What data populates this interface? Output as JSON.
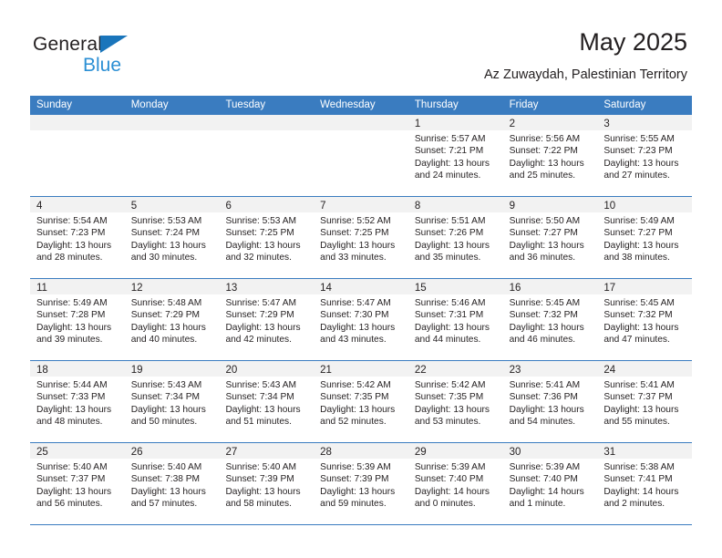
{
  "brand": {
    "name_dark": "General",
    "name_blue": "Blue",
    "triangle_color": "#1a75bb",
    "blue_text_color": "#2b8fd4"
  },
  "header": {
    "title": "May 2025",
    "subtitle": "Az Zuwaydah, Palestinian Territory"
  },
  "theme": {
    "header_row_bg": "#3a7cc0",
    "header_row_text": "#ffffff",
    "daynum_band_bg": "#f2f2f2",
    "grid_line": "#3a7cc0",
    "body_text": "#231f20"
  },
  "calendar": {
    "weekday_headers": [
      "Sunday",
      "Monday",
      "Tuesday",
      "Wednesday",
      "Thursday",
      "Friday",
      "Saturday"
    ],
    "weeks": [
      [
        {
          "day": "",
          "lines": []
        },
        {
          "day": "",
          "lines": []
        },
        {
          "day": "",
          "lines": []
        },
        {
          "day": "",
          "lines": []
        },
        {
          "day": "1",
          "lines": [
            "Sunrise: 5:57 AM",
            "Sunset: 7:21 PM",
            "Daylight: 13 hours",
            "and 24 minutes."
          ]
        },
        {
          "day": "2",
          "lines": [
            "Sunrise: 5:56 AM",
            "Sunset: 7:22 PM",
            "Daylight: 13 hours",
            "and 25 minutes."
          ]
        },
        {
          "day": "3",
          "lines": [
            "Sunrise: 5:55 AM",
            "Sunset: 7:23 PM",
            "Daylight: 13 hours",
            "and 27 minutes."
          ]
        }
      ],
      [
        {
          "day": "4",
          "lines": [
            "Sunrise: 5:54 AM",
            "Sunset: 7:23 PM",
            "Daylight: 13 hours",
            "and 28 minutes."
          ]
        },
        {
          "day": "5",
          "lines": [
            "Sunrise: 5:53 AM",
            "Sunset: 7:24 PM",
            "Daylight: 13 hours",
            "and 30 minutes."
          ]
        },
        {
          "day": "6",
          "lines": [
            "Sunrise: 5:53 AM",
            "Sunset: 7:25 PM",
            "Daylight: 13 hours",
            "and 32 minutes."
          ]
        },
        {
          "day": "7",
          "lines": [
            "Sunrise: 5:52 AM",
            "Sunset: 7:25 PM",
            "Daylight: 13 hours",
            "and 33 minutes."
          ]
        },
        {
          "day": "8",
          "lines": [
            "Sunrise: 5:51 AM",
            "Sunset: 7:26 PM",
            "Daylight: 13 hours",
            "and 35 minutes."
          ]
        },
        {
          "day": "9",
          "lines": [
            "Sunrise: 5:50 AM",
            "Sunset: 7:27 PM",
            "Daylight: 13 hours",
            "and 36 minutes."
          ]
        },
        {
          "day": "10",
          "lines": [
            "Sunrise: 5:49 AM",
            "Sunset: 7:27 PM",
            "Daylight: 13 hours",
            "and 38 minutes."
          ]
        }
      ],
      [
        {
          "day": "11",
          "lines": [
            "Sunrise: 5:49 AM",
            "Sunset: 7:28 PM",
            "Daylight: 13 hours",
            "and 39 minutes."
          ]
        },
        {
          "day": "12",
          "lines": [
            "Sunrise: 5:48 AM",
            "Sunset: 7:29 PM",
            "Daylight: 13 hours",
            "and 40 minutes."
          ]
        },
        {
          "day": "13",
          "lines": [
            "Sunrise: 5:47 AM",
            "Sunset: 7:29 PM",
            "Daylight: 13 hours",
            "and 42 minutes."
          ]
        },
        {
          "day": "14",
          "lines": [
            "Sunrise: 5:47 AM",
            "Sunset: 7:30 PM",
            "Daylight: 13 hours",
            "and 43 minutes."
          ]
        },
        {
          "day": "15",
          "lines": [
            "Sunrise: 5:46 AM",
            "Sunset: 7:31 PM",
            "Daylight: 13 hours",
            "and 44 minutes."
          ]
        },
        {
          "day": "16",
          "lines": [
            "Sunrise: 5:45 AM",
            "Sunset: 7:32 PM",
            "Daylight: 13 hours",
            "and 46 minutes."
          ]
        },
        {
          "day": "17",
          "lines": [
            "Sunrise: 5:45 AM",
            "Sunset: 7:32 PM",
            "Daylight: 13 hours",
            "and 47 minutes."
          ]
        }
      ],
      [
        {
          "day": "18",
          "lines": [
            "Sunrise: 5:44 AM",
            "Sunset: 7:33 PM",
            "Daylight: 13 hours",
            "and 48 minutes."
          ]
        },
        {
          "day": "19",
          "lines": [
            "Sunrise: 5:43 AM",
            "Sunset: 7:34 PM",
            "Daylight: 13 hours",
            "and 50 minutes."
          ]
        },
        {
          "day": "20",
          "lines": [
            "Sunrise: 5:43 AM",
            "Sunset: 7:34 PM",
            "Daylight: 13 hours",
            "and 51 minutes."
          ]
        },
        {
          "day": "21",
          "lines": [
            "Sunrise: 5:42 AM",
            "Sunset: 7:35 PM",
            "Daylight: 13 hours",
            "and 52 minutes."
          ]
        },
        {
          "day": "22",
          "lines": [
            "Sunrise: 5:42 AM",
            "Sunset: 7:35 PM",
            "Daylight: 13 hours",
            "and 53 minutes."
          ]
        },
        {
          "day": "23",
          "lines": [
            "Sunrise: 5:41 AM",
            "Sunset: 7:36 PM",
            "Daylight: 13 hours",
            "and 54 minutes."
          ]
        },
        {
          "day": "24",
          "lines": [
            "Sunrise: 5:41 AM",
            "Sunset: 7:37 PM",
            "Daylight: 13 hours",
            "and 55 minutes."
          ]
        }
      ],
      [
        {
          "day": "25",
          "lines": [
            "Sunrise: 5:40 AM",
            "Sunset: 7:37 PM",
            "Daylight: 13 hours",
            "and 56 minutes."
          ]
        },
        {
          "day": "26",
          "lines": [
            "Sunrise: 5:40 AM",
            "Sunset: 7:38 PM",
            "Daylight: 13 hours",
            "and 57 minutes."
          ]
        },
        {
          "day": "27",
          "lines": [
            "Sunrise: 5:40 AM",
            "Sunset: 7:39 PM",
            "Daylight: 13 hours",
            "and 58 minutes."
          ]
        },
        {
          "day": "28",
          "lines": [
            "Sunrise: 5:39 AM",
            "Sunset: 7:39 PM",
            "Daylight: 13 hours",
            "and 59 minutes."
          ]
        },
        {
          "day": "29",
          "lines": [
            "Sunrise: 5:39 AM",
            "Sunset: 7:40 PM",
            "Daylight: 14 hours",
            "and 0 minutes."
          ]
        },
        {
          "day": "30",
          "lines": [
            "Sunrise: 5:39 AM",
            "Sunset: 7:40 PM",
            "Daylight: 14 hours",
            "and 1 minute."
          ]
        },
        {
          "day": "31",
          "lines": [
            "Sunrise: 5:38 AM",
            "Sunset: 7:41 PM",
            "Daylight: 14 hours",
            "and 2 minutes."
          ]
        }
      ]
    ]
  }
}
